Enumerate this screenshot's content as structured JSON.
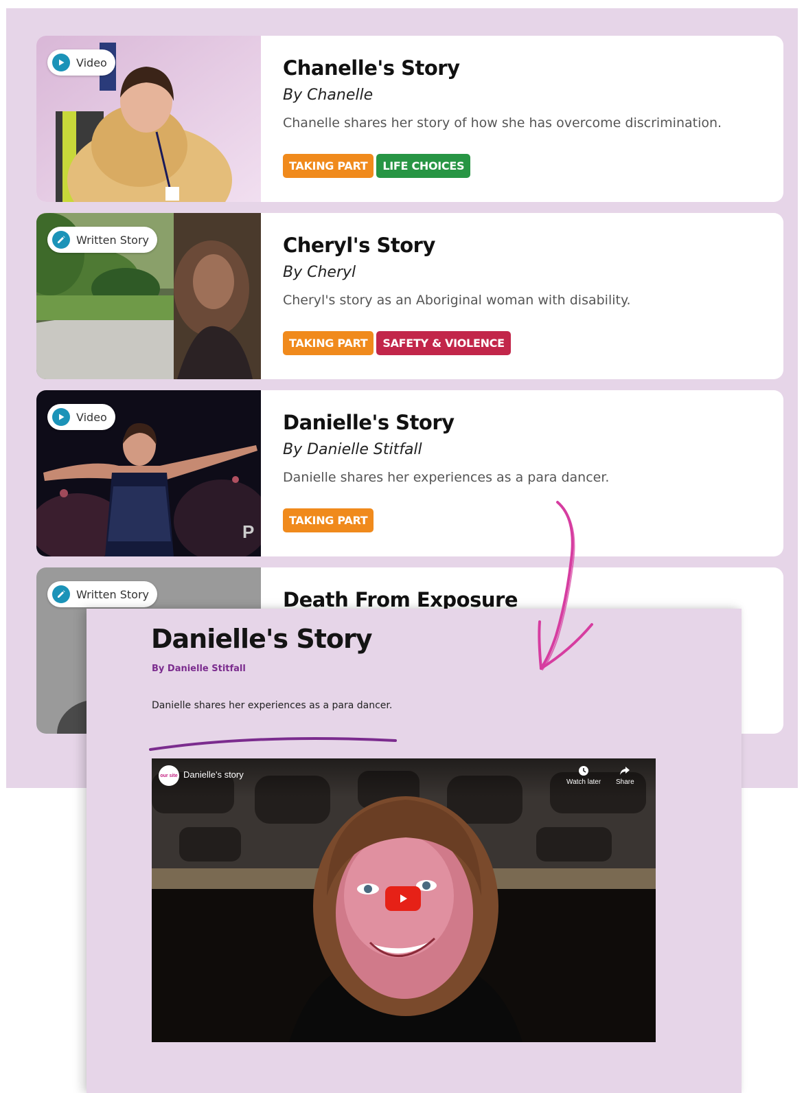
{
  "stories": [
    {
      "type_label": "Video",
      "type_icon": "play-icon",
      "title": "Chanelle's Story",
      "author": "By Chanelle",
      "description": "Chanelle shares her story of how she has overcome discrimination.",
      "tags": [
        {
          "label": "TAKING PART",
          "color": "#f08a1c"
        },
        {
          "label": "LIFE CHOICES",
          "color": "#279544"
        }
      ]
    },
    {
      "type_label": "Written Story",
      "type_icon": "pencil-icon",
      "title": "Cheryl's Story",
      "author": "By Cheryl",
      "description": "Cheryl's story as an Aboriginal woman with disability.",
      "tags": [
        {
          "label": "TAKING PART",
          "color": "#f08a1c"
        },
        {
          "label": "SAFETY & VIOLENCE",
          "color": "#c2264a"
        }
      ]
    },
    {
      "type_label": "Video",
      "type_icon": "play-icon",
      "title": "Danielle's Story",
      "author": "By Danielle Stitfall",
      "description": "Danielle shares her experiences as a para dancer.",
      "tags": [
        {
          "label": "TAKING PART",
          "color": "#f08a1c"
        }
      ]
    },
    {
      "type_label": "Written Story",
      "type_icon": "pencil-icon",
      "title": "Death From Exposure",
      "author": "",
      "description": "",
      "tags": []
    }
  ],
  "detail": {
    "title": "Danielle's Story",
    "author": "By Danielle Stitfall",
    "description": "Danielle shares her experiences as a para dancer.",
    "video": {
      "channel_logo_text": "our site",
      "title": "Danielle's story",
      "watch_later_label": "Watch later",
      "share_label": "Share"
    }
  },
  "colors": {
    "panel_bg": "#e6d5e8",
    "icon_teal": "#1b93b8",
    "accent_purple": "#7b2c8e",
    "doodle_pink": "#d63da0",
    "youtube_red": "#e62117"
  }
}
